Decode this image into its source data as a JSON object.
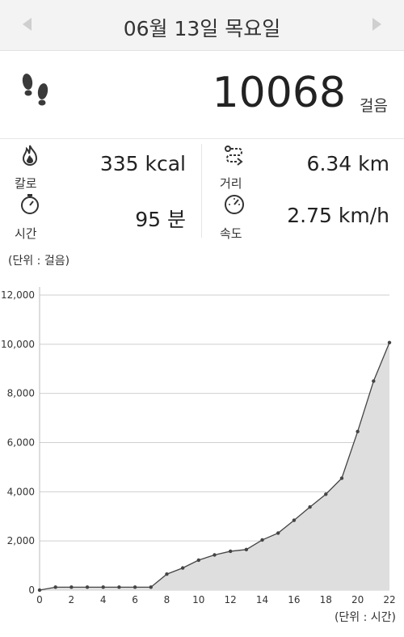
{
  "header": {
    "date": "06월 13일 목요일",
    "prev_icon": "left-triangle",
    "next_icon": "right-triangle"
  },
  "steps": {
    "value": "10068",
    "unit": "걸음",
    "icon": "footprints-icon"
  },
  "stats": {
    "calories": {
      "label": "칼로",
      "value": "335 kcal",
      "icon": "flame-icon"
    },
    "distance": {
      "label": "거리",
      "value": "6.34 km",
      "icon": "route-icon"
    },
    "time": {
      "label": "시간",
      "value": "95 분",
      "icon": "stopwatch-icon"
    },
    "speed": {
      "label": "속도",
      "value": "2.75 km/h",
      "icon": "speedometer-icon"
    }
  },
  "chart_unit_y": "(단위 : 걸음)",
  "chart_unit_x": "(단위 : 시간)",
  "chart_data": {
    "type": "area",
    "x": [
      0,
      1,
      2,
      3,
      4,
      5,
      6,
      7,
      8,
      9,
      10,
      11,
      12,
      13,
      14,
      15,
      16,
      17,
      18,
      19,
      20,
      21,
      22
    ],
    "values": [
      0,
      120,
      120,
      120,
      120,
      120,
      120,
      120,
      650,
      900,
      1220,
      1430,
      1580,
      1650,
      2040,
      2320,
      2840,
      3380,
      3900,
      4550,
      6450,
      8500,
      10068
    ],
    "xticks": [
      0,
      2,
      4,
      6,
      8,
      10,
      12,
      14,
      16,
      18,
      20,
      22
    ],
    "yticks": [
      0,
      2000,
      4000,
      6000,
      8000,
      10000,
      12000
    ],
    "ytick_labels": [
      "0",
      "2,000",
      "4,000",
      "6,000",
      "8,000",
      "10,000",
      "12,000"
    ],
    "ylim": [
      0,
      12000
    ],
    "xlim": [
      0,
      22
    ],
    "grid": true,
    "colors": {
      "fill": "#dedede",
      "line": "#444444",
      "grid": "#cfcfcf"
    }
  }
}
